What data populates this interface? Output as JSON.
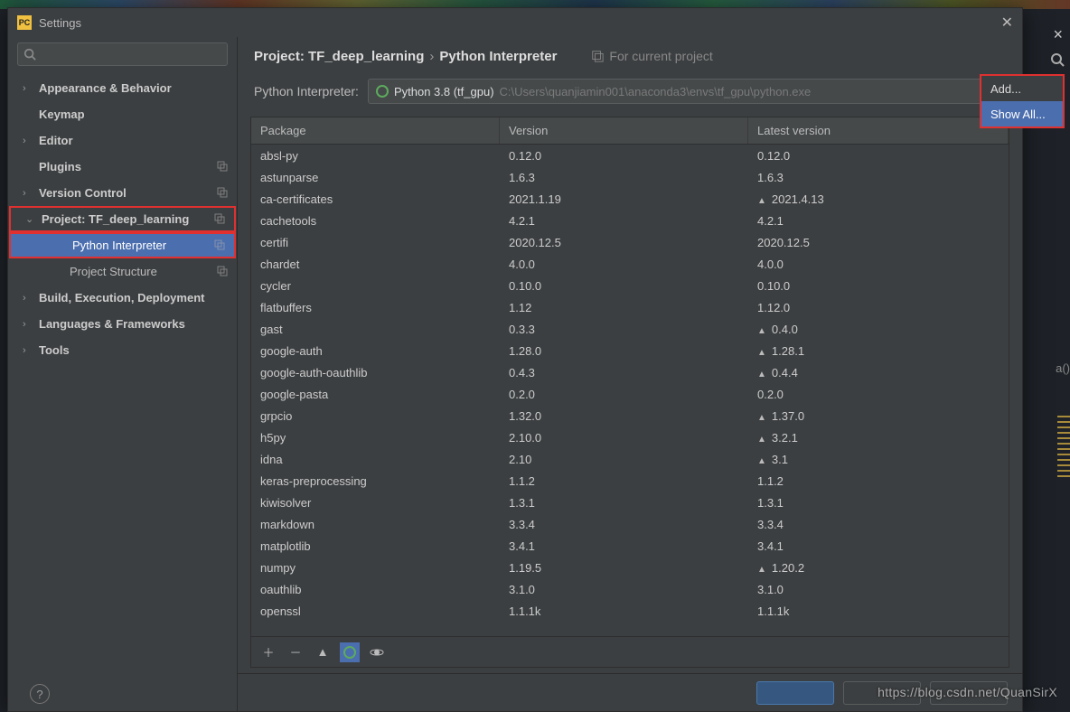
{
  "window": {
    "title": "Settings",
    "appicon_text": "PC"
  },
  "sidebar": {
    "items": [
      {
        "label": "Appearance & Behavior",
        "chevron": "›",
        "bold": true,
        "copy": false
      },
      {
        "label": "Keymap",
        "chevron": "",
        "bold": true,
        "copy": false
      },
      {
        "label": "Editor",
        "chevron": "›",
        "bold": true,
        "copy": false
      },
      {
        "label": "Plugins",
        "chevron": "",
        "bold": true,
        "copy": true
      },
      {
        "label": "Version Control",
        "chevron": "›",
        "bold": true,
        "copy": true
      },
      {
        "label": "Project: TF_deep_learning",
        "chevron": "⌄",
        "bold": true,
        "copy": true,
        "redbox": true
      },
      {
        "label": "Python Interpreter",
        "chevron": "",
        "bold": false,
        "copy": true,
        "child": true,
        "selected": true,
        "redbox": true
      },
      {
        "label": "Project Structure",
        "chevron": "",
        "bold": false,
        "copy": true,
        "child": true
      },
      {
        "label": "Build, Execution, Deployment",
        "chevron": "›",
        "bold": true,
        "copy": false
      },
      {
        "label": "Languages & Frameworks",
        "chevron": "›",
        "bold": true,
        "copy": false
      },
      {
        "label": "Tools",
        "chevron": "›",
        "bold": true,
        "copy": false
      }
    ]
  },
  "breadcrumb": {
    "a": "Project: TF_deep_learning",
    "sep": "›",
    "b": "Python Interpreter",
    "for_current": "For current project"
  },
  "interpreter": {
    "label": "Python Interpreter:",
    "name": "Python 3.8 (tf_gpu)",
    "path": "C:\\Users\\quanjiamin001\\anaconda3\\envs\\tf_gpu\\python.exe"
  },
  "menu": {
    "add": "Add...",
    "show_all": "Show All..."
  },
  "table": {
    "headers": {
      "pkg": "Package",
      "ver": "Version",
      "lat": "Latest version"
    },
    "rows": [
      {
        "pkg": "absl-py",
        "ver": "0.12.0",
        "lat": "0.12.0",
        "up": false
      },
      {
        "pkg": "astunparse",
        "ver": "1.6.3",
        "lat": "1.6.3",
        "up": false
      },
      {
        "pkg": "ca-certificates",
        "ver": "2021.1.19",
        "lat": "2021.4.13",
        "up": true
      },
      {
        "pkg": "cachetools",
        "ver": "4.2.1",
        "lat": "4.2.1",
        "up": false
      },
      {
        "pkg": "certifi",
        "ver": "2020.12.5",
        "lat": "2020.12.5",
        "up": false
      },
      {
        "pkg": "chardet",
        "ver": "4.0.0",
        "lat": "4.0.0",
        "up": false
      },
      {
        "pkg": "cycler",
        "ver": "0.10.0",
        "lat": "0.10.0",
        "up": false
      },
      {
        "pkg": "flatbuffers",
        "ver": "1.12",
        "lat": "1.12.0",
        "up": false
      },
      {
        "pkg": "gast",
        "ver": "0.3.3",
        "lat": "0.4.0",
        "up": true
      },
      {
        "pkg": "google-auth",
        "ver": "1.28.0",
        "lat": "1.28.1",
        "up": true
      },
      {
        "pkg": "google-auth-oauthlib",
        "ver": "0.4.3",
        "lat": "0.4.4",
        "up": true
      },
      {
        "pkg": "google-pasta",
        "ver": "0.2.0",
        "lat": "0.2.0",
        "up": false
      },
      {
        "pkg": "grpcio",
        "ver": "1.32.0",
        "lat": "1.37.0",
        "up": true
      },
      {
        "pkg": "h5py",
        "ver": "2.10.0",
        "lat": "3.2.1",
        "up": true
      },
      {
        "pkg": "idna",
        "ver": "2.10",
        "lat": "3.1",
        "up": true
      },
      {
        "pkg": "keras-preprocessing",
        "ver": "1.1.2",
        "lat": "1.1.2",
        "up": false
      },
      {
        "pkg": "kiwisolver",
        "ver": "1.3.1",
        "lat": "1.3.1",
        "up": false
      },
      {
        "pkg": "markdown",
        "ver": "3.3.4",
        "lat": "3.3.4",
        "up": false
      },
      {
        "pkg": "matplotlib",
        "ver": "3.4.1",
        "lat": "3.4.1",
        "up": false
      },
      {
        "pkg": "numpy",
        "ver": "1.19.5",
        "lat": "1.20.2",
        "up": true
      },
      {
        "pkg": "oauthlib",
        "ver": "3.1.0",
        "lat": "3.1.0",
        "up": false
      },
      {
        "pkg": "openssl",
        "ver": "1.1.1k",
        "lat": "1.1.1k",
        "up": false
      }
    ]
  },
  "bg_code": "a()",
  "watermark": "https://blog.csdn.net/QuanSirX"
}
